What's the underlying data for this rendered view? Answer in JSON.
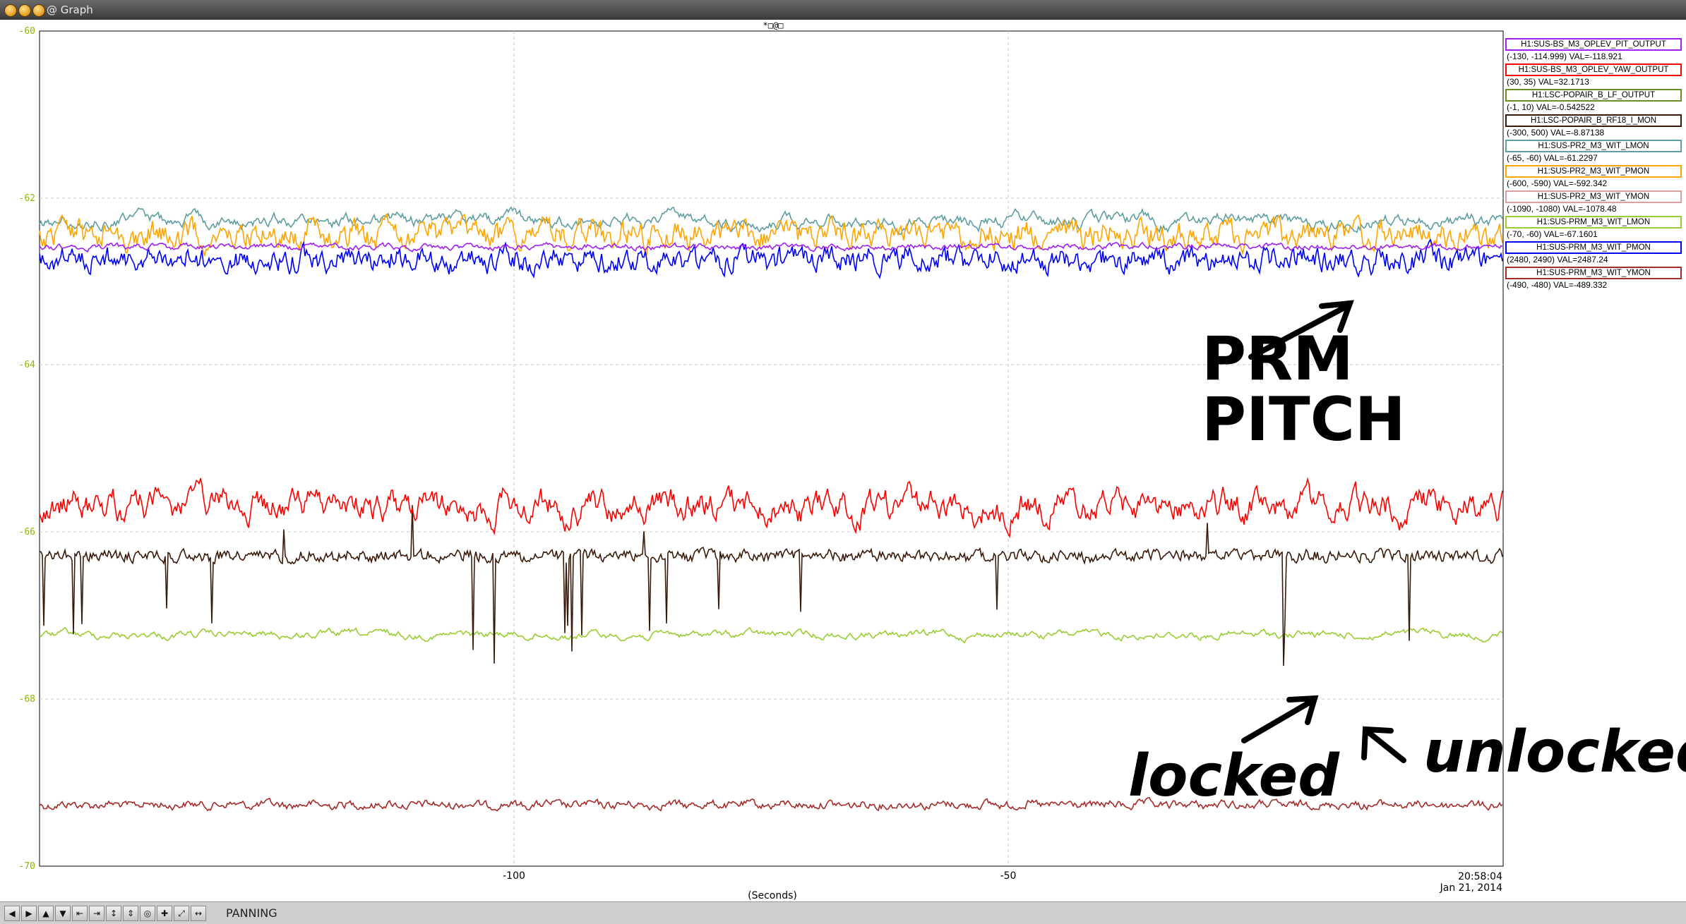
{
  "window": {
    "title": "@ Graph"
  },
  "top_glyphs": "*□@□",
  "y_axis": {
    "ticks": [
      "-60",
      "-62",
      "-64",
      "-66",
      "-68",
      "-70"
    ]
  },
  "x_axis": {
    "label": "(Seconds)",
    "ticks": [
      "-100",
      "-50"
    ],
    "end_time": "20:58:04",
    "end_date": "Jan 21, 2014"
  },
  "legend": [
    {
      "name": "H1:SUS-BS_M3_OPLEV_PIT_OUTPUT",
      "range": "(-130, -114.999) VAL=-118.921",
      "color": "#a020f0"
    },
    {
      "name": "H1:SUS-BS_M3_OPLEV_YAW_OUTPUT",
      "range": "(30, 35) VAL=32.1713",
      "color": "#ff0000"
    },
    {
      "name": "H1:LSC-POPAIR_B_LF_OUTPUT",
      "range": "(-1, 10) VAL=-0.542522",
      "color": "#6b8e23"
    },
    {
      "name": "H1:LSC-POPAIR_B_RF18_I_MON",
      "range": "(-300, 500) VAL=-8.87138",
      "color": "#3a1a0a"
    },
    {
      "name": "H1:SUS-PR2_M3_WIT_LMON",
      "range": "(-65, -60) VAL=-61.2297",
      "color": "#5f9ea0"
    },
    {
      "name": "H1:SUS-PR2_M3_WIT_PMON",
      "range": "(-600, -590) VAL=-592.342",
      "color": "#ffa500"
    },
    {
      "name": "H1:SUS-PR2_M3_WIT_YMON",
      "range": "(-1090, -1080) VAL=-1078.48",
      "color": "#d8a0a0"
    },
    {
      "name": "H1:SUS-PRM_M3_WIT_LMON",
      "range": "(-70, -60) VAL=-67.1601",
      "color": "#9acd32"
    },
    {
      "name": "H1:SUS-PRM_M3_WIT_PMON",
      "range": "(2480, 2490) VAL=2487.24",
      "color": "#0000ff"
    },
    {
      "name": "H1:SUS-PRM_M3_WIT_YMON",
      "range": "(-490, -480) VAL=-489.332",
      "color": "#a52a2a"
    }
  ],
  "annotations": {
    "prm_line1": "PRM",
    "prm_line2": "PITCH",
    "locked": "locked",
    "unlocked": "unlocked"
  },
  "toolbar": {
    "buttons": [
      "◀",
      "▶",
      "▲",
      "▼",
      "⇤",
      "⇥",
      "↕",
      "⇕",
      "◎",
      "✚",
      "⤢",
      "↔"
    ],
    "status": "PANNING"
  }
}
